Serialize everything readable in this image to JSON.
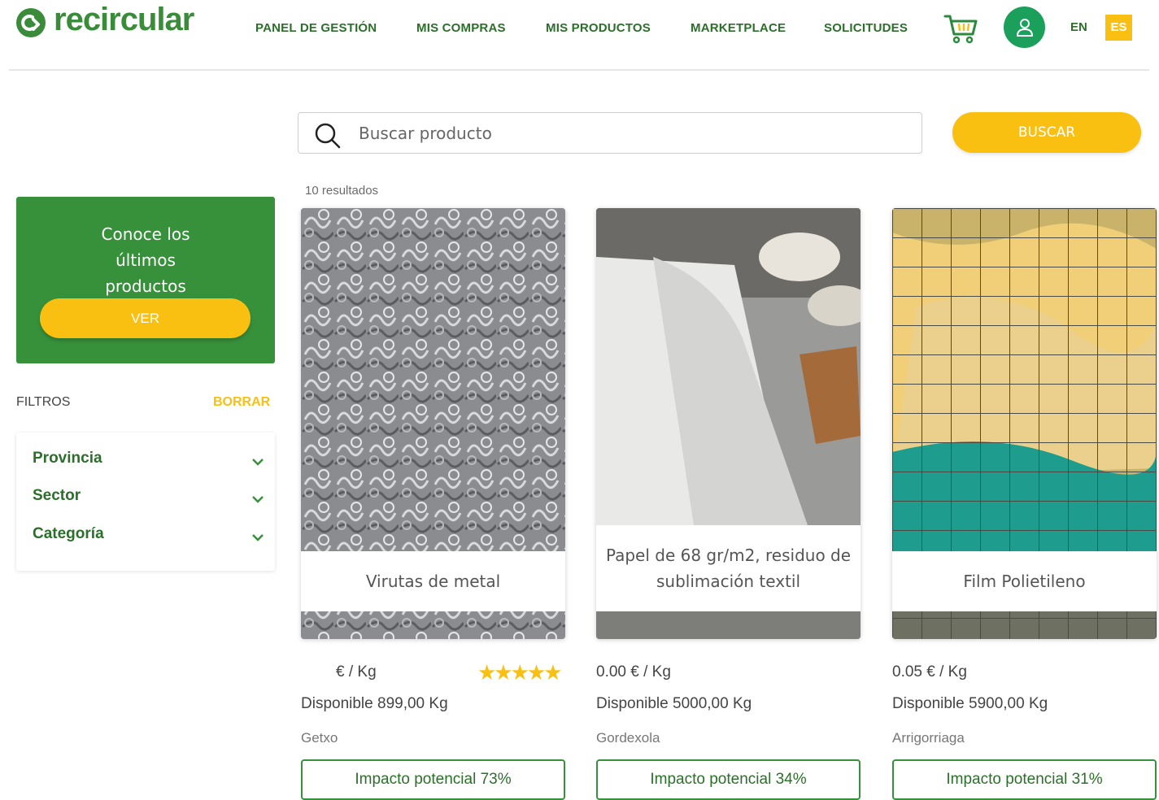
{
  "brand": {
    "name": "recircular",
    "color": "#3a8c3a"
  },
  "nav": {
    "items": [
      "PANEL DE GESTIÓN",
      "MIS COMPRAS",
      "MIS PRODUCTOS",
      "MARKETPLACE",
      "SOLICITUDES"
    ],
    "lang_en": "EN",
    "lang_es": "ES"
  },
  "search": {
    "placeholder": "Buscar producto",
    "button": "BUSCAR",
    "results": "10 resultados"
  },
  "promo": {
    "text": "Conoce los últimos productos",
    "button": "VER"
  },
  "filters": {
    "title": "FILTROS",
    "clear": "BORRAR",
    "items": [
      "Provincia",
      "Sector",
      "Categoría"
    ]
  },
  "products": [
    {
      "title": "Virutas de metal",
      "price": "€ / Kg",
      "stars": "★★★★★",
      "available": "Disponible 899,00 Kg",
      "city": "Getxo",
      "impact": "Impacto potencial 73%",
      "image": "metal-shavings"
    },
    {
      "title": "Papel de 68 gr/m2, residuo de sublimación textil",
      "price": "0.00 € / Kg",
      "available": "Disponible 5000,00 Kg",
      "city": "Gordexola",
      "impact": "Impacto potencial 34%",
      "image": "paper-rolls"
    },
    {
      "title": "Film Polietileno",
      "price": "0.05 € / Kg",
      "available": "Disponible 5900,00 Kg",
      "city": "Arrigorriaga",
      "impact": "Impacto potencial 31%",
      "image": "plastic-film-cage"
    }
  ],
  "colors": {
    "green": "#37913b",
    "yellow": "#f9c012",
    "dark_green_text": "#2b6f2b"
  }
}
